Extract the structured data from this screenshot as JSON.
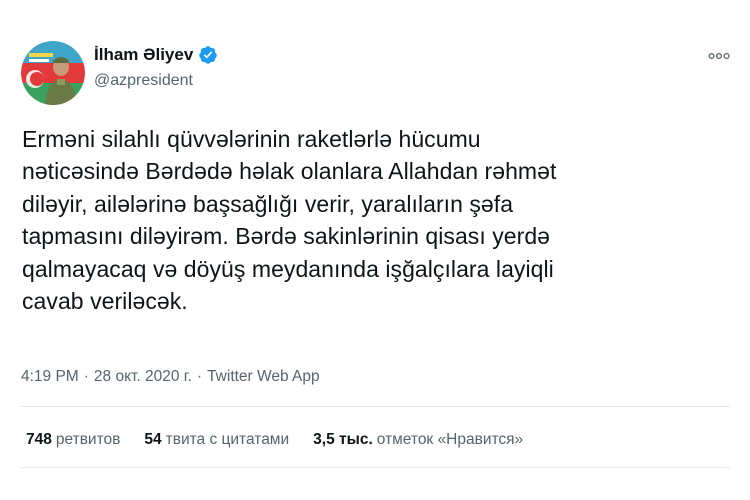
{
  "author": {
    "name": "İlham Əliyev",
    "handle": "@azpresident",
    "verified": true
  },
  "tweet": {
    "lines": [
      "Erməni silahlı qüvvələrinin raketlərlə hücumu",
      "nəticəsində Bərdədə həlak olanlara Allahdan rəhmət",
      "diləyir, ailələrinə başsağlığı verir, yaralıların şəfa",
      "tapmasını diləyirəm. Bərdə sakinlərinin qisası yerdə",
      "qalmayacaq və döyüş meydanında işğalçılara layiqli",
      "cavab veriləcək."
    ]
  },
  "meta": {
    "time": "4:19 PM",
    "separator": "·",
    "date": "28 окт. 2020 г.",
    "source": "Twitter Web App"
  },
  "stats": {
    "retweets_count": "748",
    "retweets_label": "ретвитов",
    "quotes_count": "54",
    "quotes_label": "твита с цитатами",
    "likes_count": "3,5 тыс.",
    "likes_label": "отметок «Нравится»"
  },
  "colors": {
    "text_primary": "#0f1419",
    "text_secondary": "#536471",
    "verified_blue": "#1d9bf0",
    "divider": "#e1e8ed"
  },
  "icons": {
    "verified": "verified-badge-icon",
    "more": "more-options-icon"
  }
}
